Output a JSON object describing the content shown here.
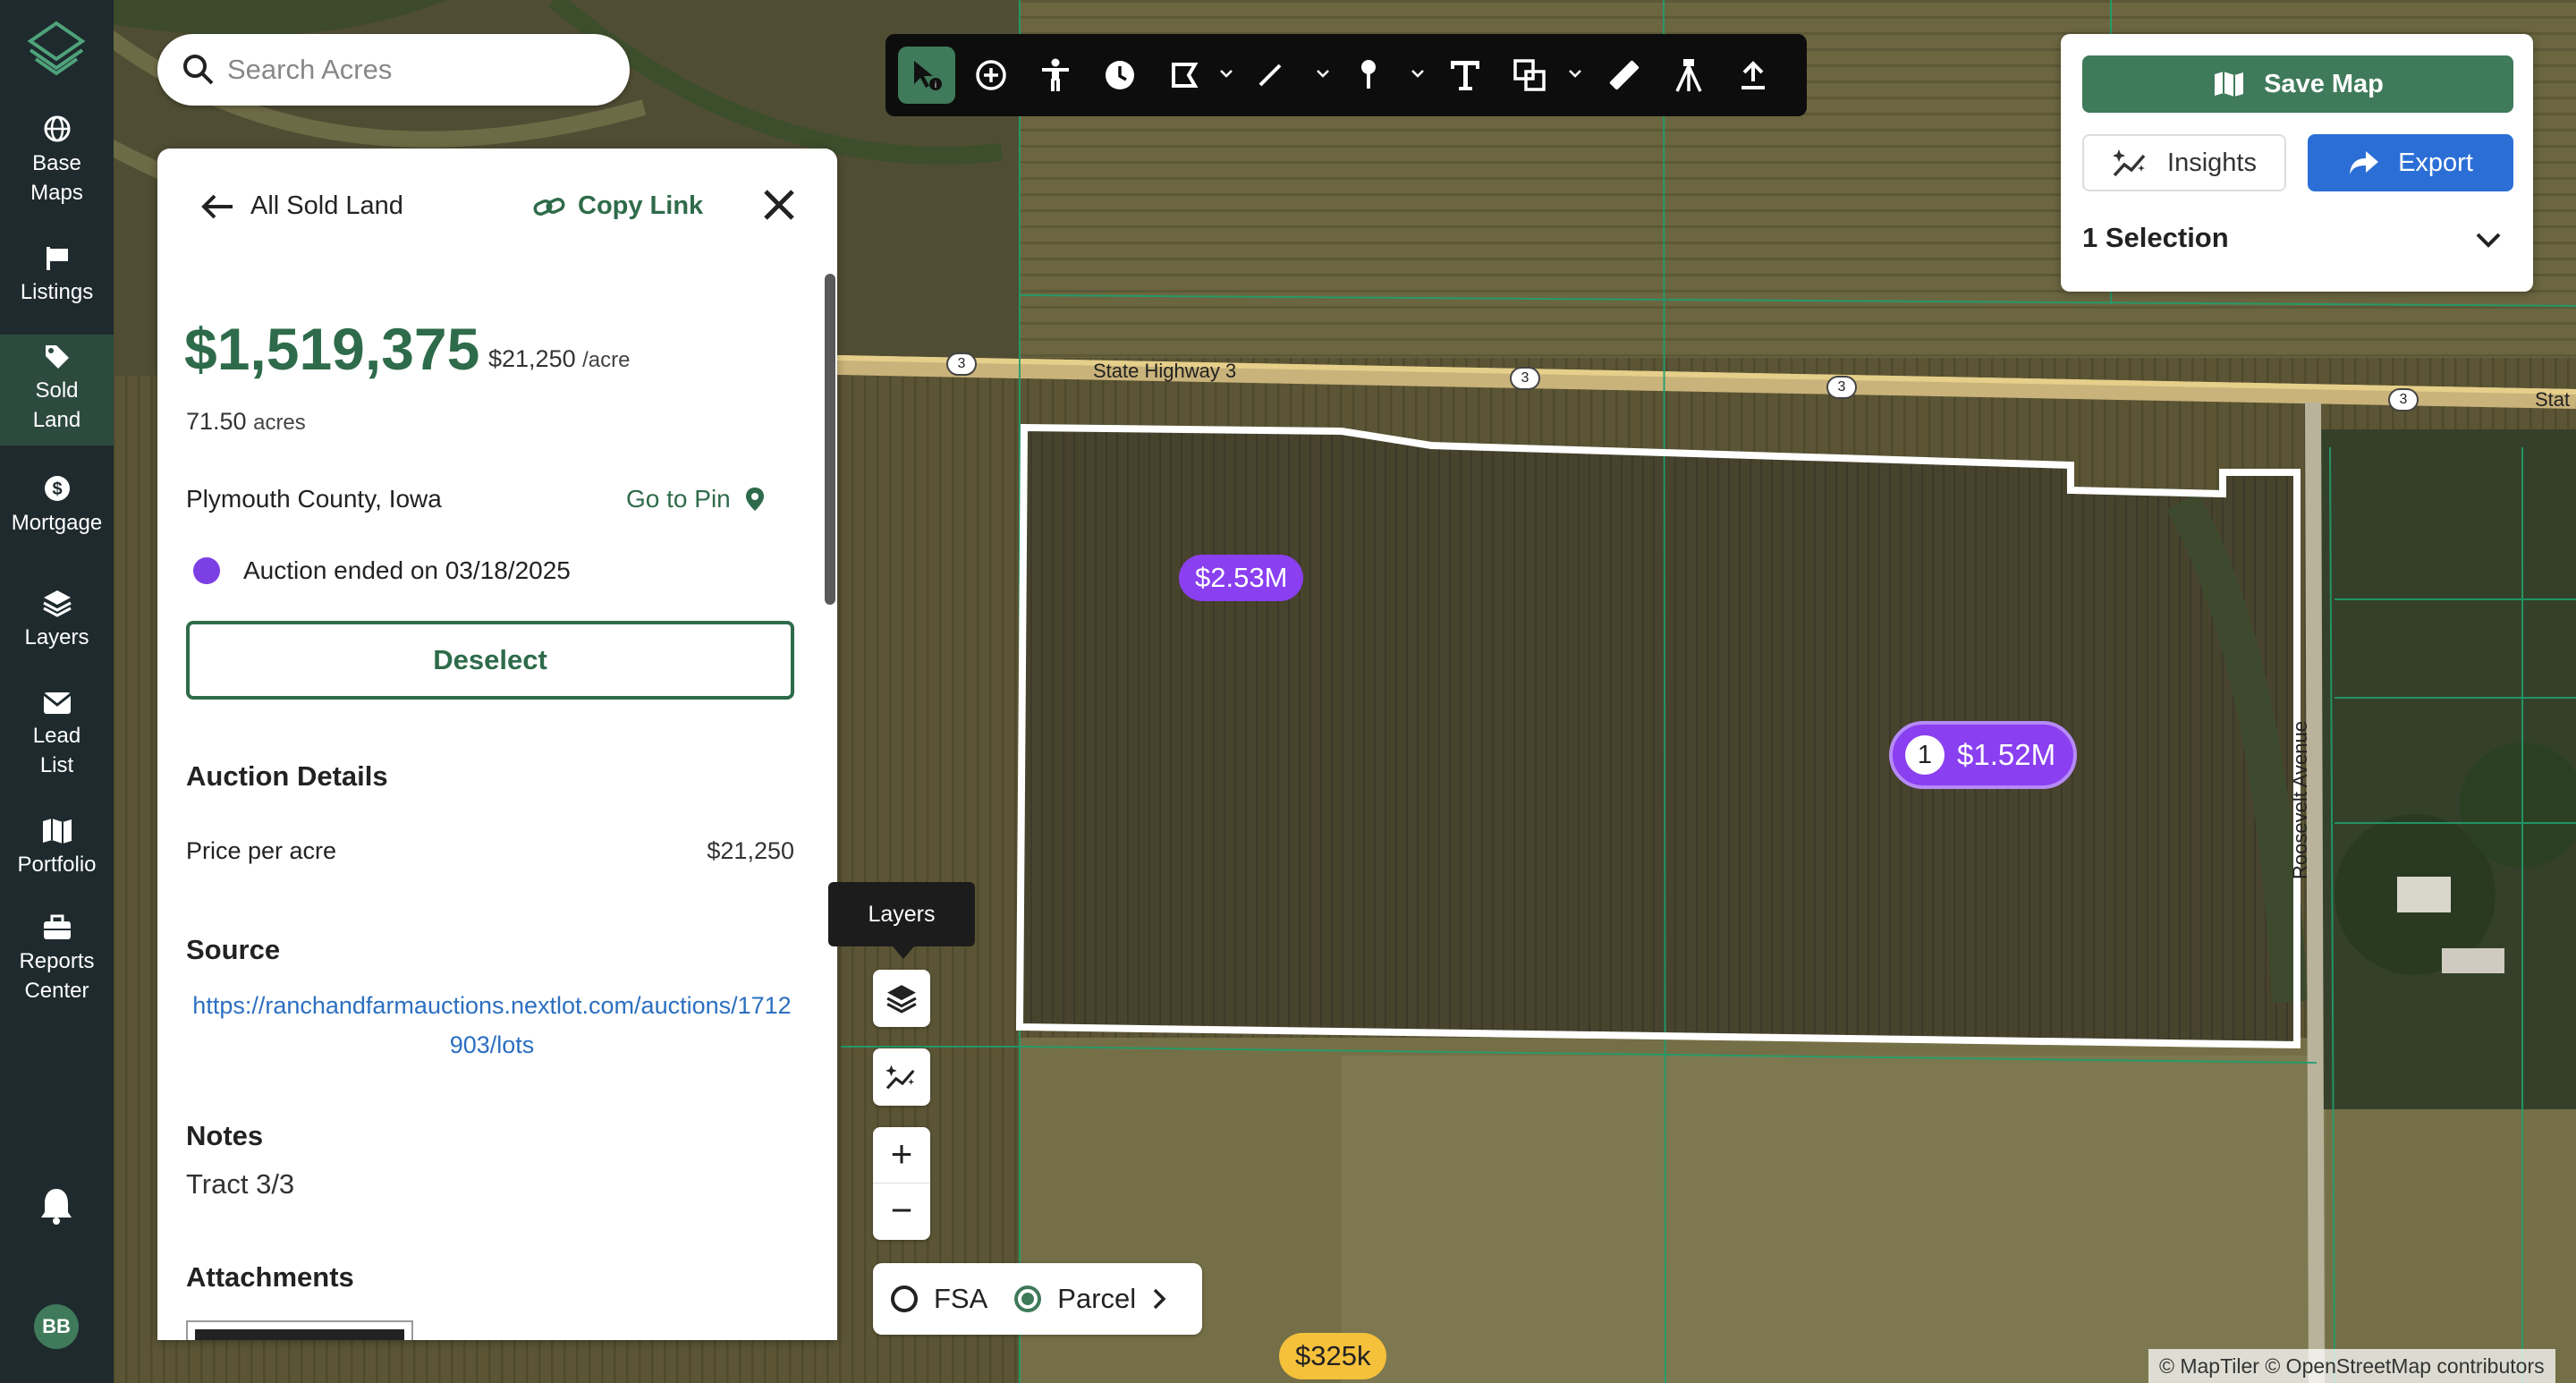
{
  "app": {
    "search_placeholder": "Search Acres"
  },
  "rail": {
    "items": [
      {
        "label_1": "Base",
        "label_2": "Maps"
      },
      {
        "label_1": "Listings"
      },
      {
        "label_1": "Sold",
        "label_2": "Land"
      },
      {
        "label_1": "Mortgage"
      },
      {
        "label_1": "Layers"
      },
      {
        "label_1": "Lead",
        "label_2": "List"
      },
      {
        "label_1": "Portfolio"
      },
      {
        "label_1": "Reports",
        "label_2": "Center"
      }
    ],
    "avatar_initials": "BB"
  },
  "panel": {
    "back_label": "All Sold Land",
    "copy_link_label": "Copy Link",
    "price": "$1,519,375",
    "price_per_acre": "$21,250",
    "price_per_acre_unit": "/acre",
    "acres_value": "71.50",
    "acres_unit": "acres",
    "county": "Plymouth County, Iowa",
    "go_to_pin_label": "Go to Pin",
    "auction_status": "Auction ended on 03/18/2025",
    "deselect_label": "Deselect",
    "auction_details_heading": "Auction Details",
    "price_per_acre_label": "Price per acre",
    "price_per_acre_value": "$21,250",
    "source_heading": "Source",
    "source_url": "https://ranchandfarmauctions.nextlot.com/auctions/1712903/lots",
    "notes_heading": "Notes",
    "notes_value": "Tract 3/3",
    "attachments_heading": "Attachments"
  },
  "right_panel": {
    "save_map_label": "Save Map",
    "insights_label": "Insights",
    "export_label": "Export",
    "selection_label": "1 Selection"
  },
  "map": {
    "tooltip_label": "Layers",
    "zoom_in": "+",
    "zoom_out": "−",
    "radio_fsa": "FSA",
    "radio_parcel": "Parcel",
    "selected_layer": "Parcel",
    "pill_1": "$2.53M",
    "pill_selected_num": "1",
    "pill_selected_value": "$1.52M",
    "pill_yellow": "$325k",
    "road_highway": "State Highway 3",
    "road_highway_cut": "Stat",
    "road_avenue": "Roosevelt Avenue",
    "shield_number": "3",
    "attribution": "© MapTiler © OpenStreetMap contributors"
  },
  "colors": {
    "brand_green": "#3f7a5a",
    "rail_bg": "#1e2a2e",
    "export_blue": "#2b6fd6",
    "auction_purple": "#7b3fe4",
    "pill_yellow": "#f5c13b"
  }
}
